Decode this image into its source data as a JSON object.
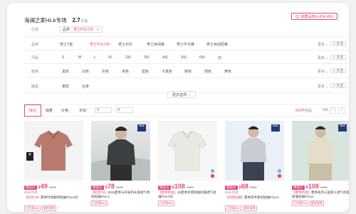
{
  "shop": {
    "title": "海澜之家HLA专场",
    "score": "2.7",
    "score_unit": "折起",
    "fav_label": "收藏品牌(4,454,496)",
    "fav_icon": "heart-icon"
  },
  "filters": {
    "selected": {
      "label": "已选",
      "chip_prefix": "品类：",
      "chip_value": "男士POLO衫",
      "chip_close": "✕"
    },
    "category": {
      "label": "品类",
      "options": [
        "男士T恤",
        "男士POLO衫",
        "男士衬衫",
        "男士休闲裤",
        "男士牛仔裤",
        "男士休闲短裤"
      ],
      "active_index": 1,
      "more": "更多",
      "multi": "+ 多选"
    },
    "size": {
      "label": "尺码",
      "options": [
        "S",
        "M",
        "L",
        "XL",
        "2XL",
        "3XL",
        "4XL",
        "5XL",
        "6XL",
        "均"
      ],
      "more": "更多",
      "multi": "+ 多选"
    },
    "color": {
      "label": "颜色",
      "options": [
        "黑色",
        "白色",
        "灰色",
        "米色",
        "蓝色",
        "卡其色",
        "棕色",
        "绿色",
        "黄色"
      ],
      "more": "更多",
      "multi": "+ 多选"
    },
    "fit": {
      "label": "版型",
      "options": [
        "宽松",
        "合身"
      ],
      "more": "更多",
      "multi": "+ 多选"
    },
    "more_options": "更多选项"
  },
  "sortbar": {
    "sorts": [
      "综合",
      "销量",
      "价格",
      "折扣"
    ],
    "active_index": 0,
    "price_min_placeholder": "¥",
    "price_sep": "-",
    "price_max_placeholder": "¥",
    "count_num": "209",
    "count_suffix": "件商品",
    "page": "1/3",
    "prev": "‹",
    "next": "›"
  },
  "products": [
    {
      "tag": "特卖价",
      "price": "49",
      "orig": "¥138",
      "sold": "60天热销",
      "title_brand": "【折后49】",
      "title": "夏季时尚翻领短袖POLO衫",
      "badges": [
        "已优惠¥89",
        "限时直降"
      ],
      "img_color": "#b87a6e",
      "bg": "#f4f4f4",
      "kind": "flat"
    },
    {
      "tag": "特卖价",
      "price": "78",
      "orig": "¥138",
      "sold": "",
      "title_brand": "【折后78】",
      "title": "2025夏季山开采风长线透气休闲短袖POLO",
      "badges": [
        "已优惠¥60"
      ],
      "img_color": "#3c3f42",
      "bg": "#d9dcdd",
      "kind": "model"
    },
    {
      "tag": "特卖价",
      "price": "108",
      "orig": "¥158",
      "sold": "",
      "title_brand": "【夏季新品】",
      "title": "25夏季凉感短袖抗菌透气短袖POLO衫",
      "badges": [
        "已优惠¥50"
      ],
      "img_color": "#e9e8e2",
      "bg": "#f6f6f4",
      "kind": "flat"
    },
    {
      "tag": "特卖价",
      "price": "68",
      "orig": "¥118",
      "sold": "60天热销",
      "title_brand": "【凉感短袖】",
      "title": "夏季商务休闲短袖POLO",
      "badges": [
        "已优惠¥50",
        "限时直降"
      ],
      "img_color": "#c9ccd2",
      "bg": "#eaf1f6",
      "kind": "model"
    },
    {
      "tag": "特卖价",
      "price": "108",
      "orig": "¥138",
      "sold": "",
      "title_brand": "【夏季新款】",
      "title": "夏季商务三国演义透气抗菌防皱短袖POLO",
      "badges": [
        "已优惠¥30",
        "限时直降"
      ],
      "img_color": "#e3ddc9",
      "bg": "#d8e4de",
      "kind": "model"
    }
  ],
  "colors": {
    "accent": "#e5487a",
    "hla_blue": "#1f3a7a"
  }
}
